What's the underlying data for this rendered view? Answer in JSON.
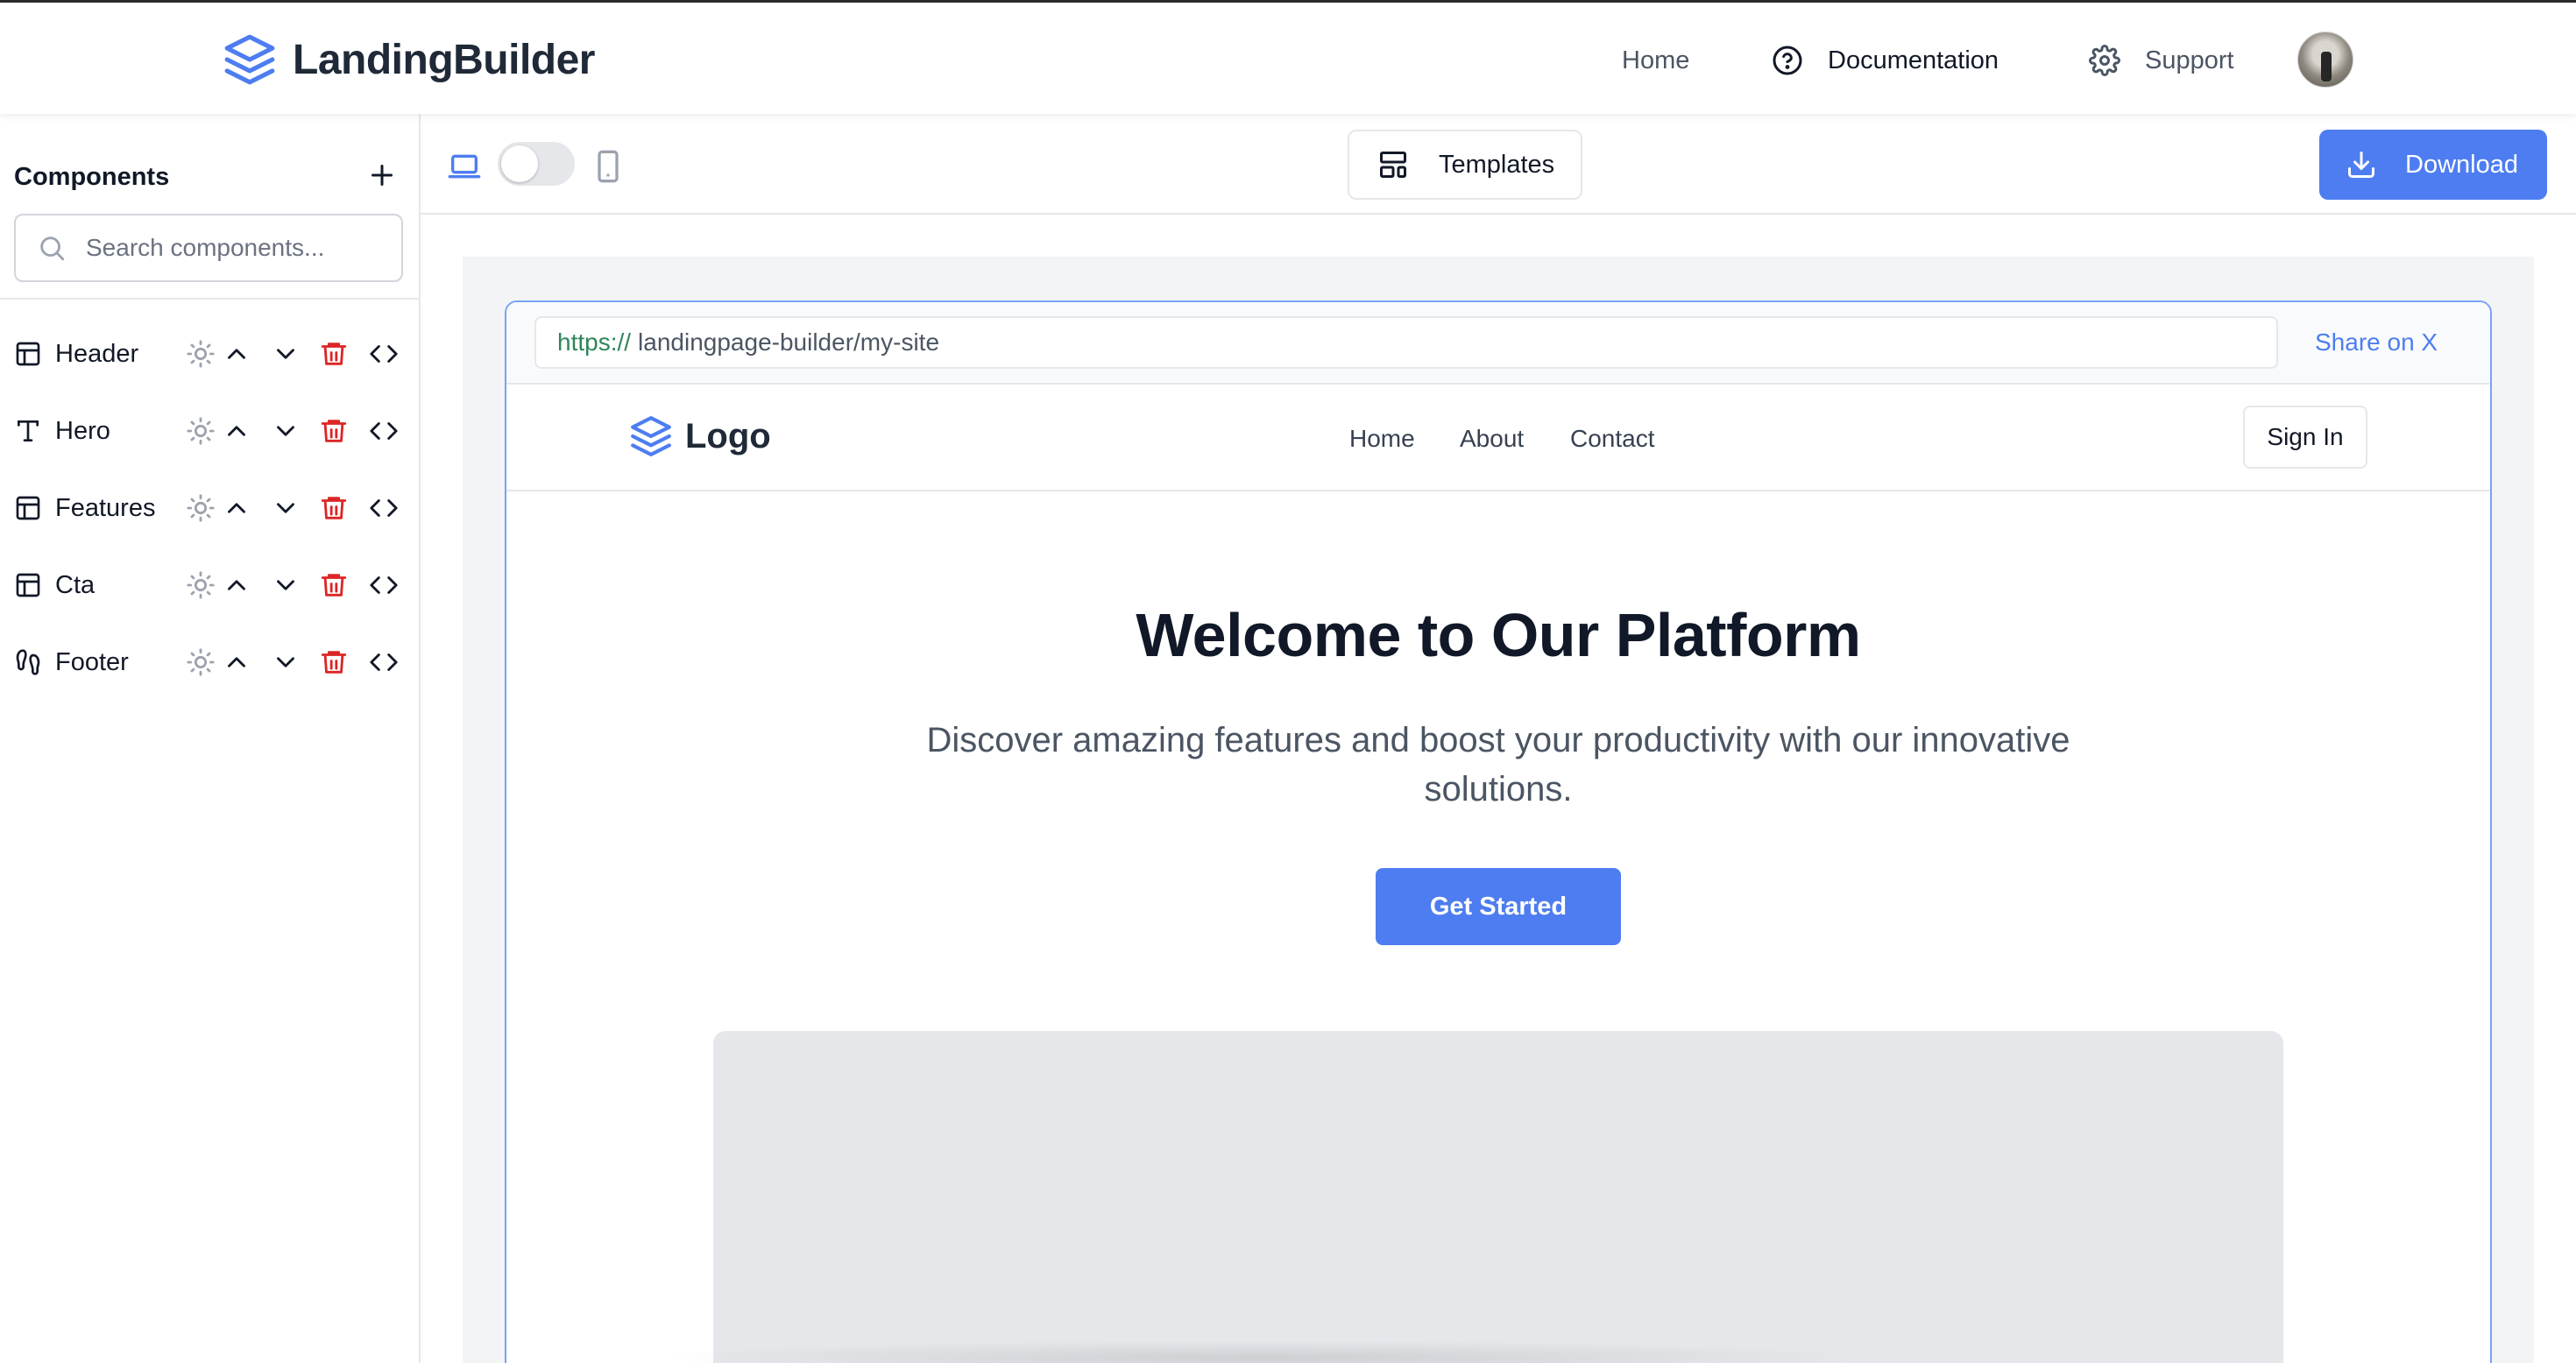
{
  "app": {
    "brand_name": "LandingBuilder",
    "accent_color": "#4d7df0"
  },
  "topnav": {
    "home": "Home",
    "documentation": "Documentation",
    "support": "Support"
  },
  "sidebar": {
    "title": "Components",
    "search_placeholder": "Search components...",
    "components": [
      {
        "label": "Header",
        "icon": "layout-icon"
      },
      {
        "label": "Hero",
        "icon": "text-type-icon"
      },
      {
        "label": "Features",
        "icon": "layout-icon"
      },
      {
        "label": "Cta",
        "icon": "layout-icon"
      },
      {
        "label": "Footer",
        "icon": "footprints-icon"
      }
    ],
    "row_actions": [
      "theme-sun-icon",
      "move-up-icon",
      "move-down-icon",
      "delete-icon",
      "code-icon"
    ]
  },
  "toolbar": {
    "templates_label": "Templates",
    "download_label": "Download",
    "view_mode": "desktop"
  },
  "preview": {
    "url_protocol": "https://",
    "url_path": "landingpage-builder/my-site",
    "share_label": "Share on X",
    "site": {
      "logo_text": "Logo",
      "nav": [
        "Home",
        "About",
        "Contact"
      ],
      "signin_label": "Sign In",
      "hero_title": "Welcome to Our Platform",
      "hero_subtitle": "Discover amazing features and boost your productivity with our innovative solutions.",
      "hero_cta": "Get Started"
    }
  }
}
